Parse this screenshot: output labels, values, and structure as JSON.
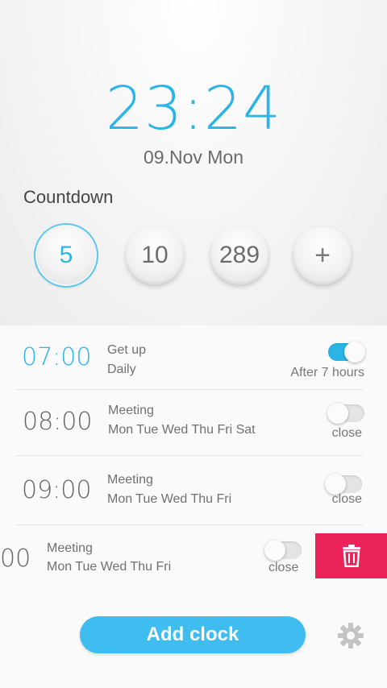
{
  "clock": {
    "time": "23:24",
    "date": "09.Nov Mon"
  },
  "countdown": {
    "title": "Countdown",
    "presets": [
      {
        "label": "5",
        "selected": true
      },
      {
        "label": "10",
        "selected": false
      },
      {
        "label": "289",
        "selected": false
      }
    ],
    "add_label": "+"
  },
  "alarms": [
    {
      "time": "07:00",
      "label": "Get up",
      "repeat": "Daily",
      "enabled": true,
      "status": "After 7 hours"
    },
    {
      "time": "08:00",
      "label": "Meeting",
      "repeat": "Mon Tue Wed Thu Fri Sat",
      "enabled": false,
      "status": "close"
    },
    {
      "time": "09:00",
      "label": "Meeting",
      "repeat": "Mon Tue Wed Thu Fri",
      "enabled": false,
      "status": "close"
    },
    {
      "time": "00",
      "label": "Meeting",
      "repeat": "Mon Tue Wed Thu Fri",
      "enabled": false,
      "status": "close"
    }
  ],
  "actions": {
    "add_clock_label": "Add clock",
    "delete_icon": "trash-icon",
    "settings_icon": "gear-icon"
  },
  "colors": {
    "accent": "#2bb4e5",
    "button": "#3fbdf0",
    "delete": "#ea2459"
  }
}
